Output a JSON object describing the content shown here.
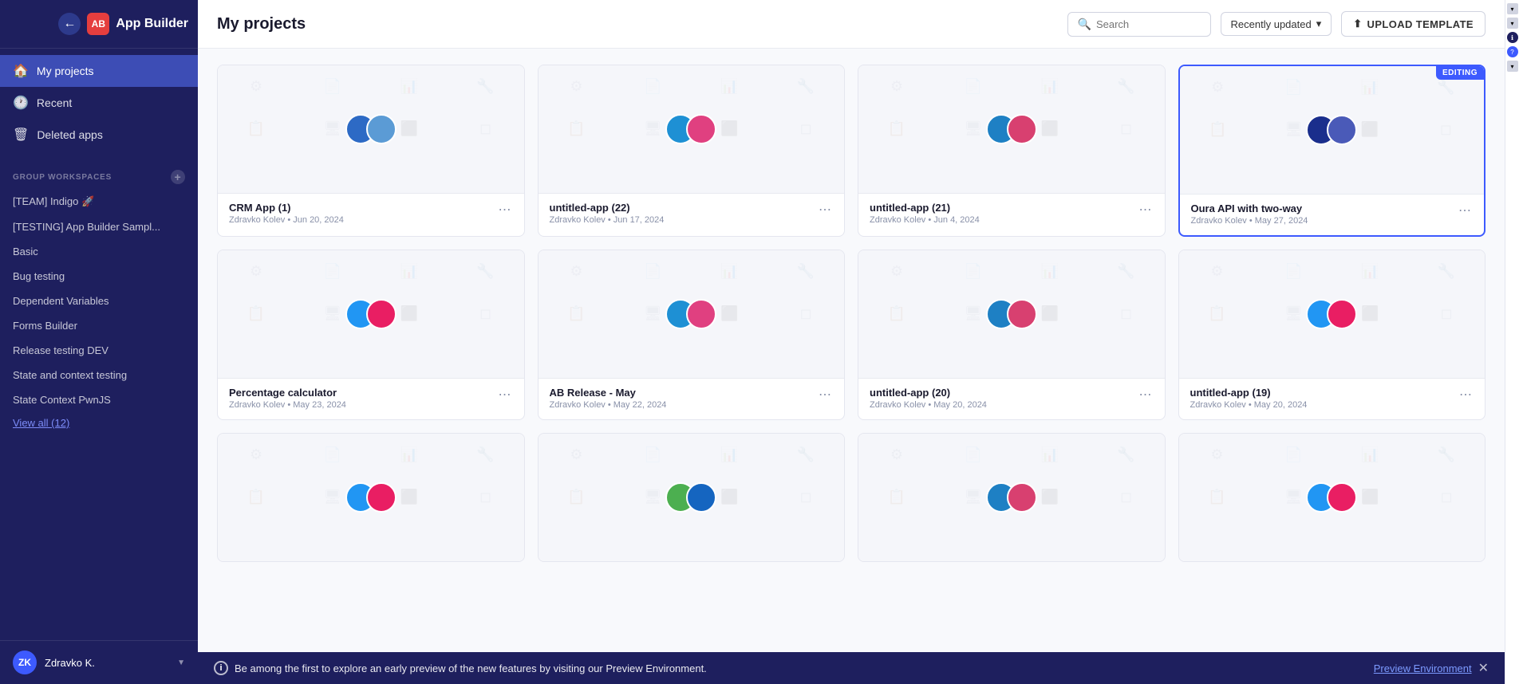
{
  "app": {
    "title": "App Builder",
    "logo_initials": "AB"
  },
  "sidebar": {
    "nav": [
      {
        "id": "my-projects",
        "label": "My projects",
        "icon": "🏠",
        "active": true
      },
      {
        "id": "recent",
        "label": "Recent",
        "icon": "🕐",
        "active": false
      },
      {
        "id": "deleted-apps",
        "label": "Deleted apps",
        "icon": "🗑",
        "active": false
      }
    ],
    "group_workspaces_label": "GROUP WORKSPACES",
    "workspaces": [
      {
        "id": "ws-team-indigo",
        "label": "[TEAM] Indigo 🚀"
      },
      {
        "id": "ws-testing-sample",
        "label": "[TESTING] App Builder Sampl..."
      },
      {
        "id": "ws-basic",
        "label": "Basic"
      },
      {
        "id": "ws-bug-testing",
        "label": "Bug testing"
      },
      {
        "id": "ws-dependent-vars",
        "label": "Dependent Variables"
      },
      {
        "id": "ws-forms-builder",
        "label": "Forms Builder"
      },
      {
        "id": "ws-release-testing",
        "label": "Release testing DEV"
      },
      {
        "id": "ws-state-context",
        "label": "State and context testing"
      },
      {
        "id": "ws-state-context-pwnjs",
        "label": "State Context PwnJS"
      }
    ],
    "view_all_label": "View all (12)",
    "user": {
      "initials": "ZK",
      "name": "Zdravko K."
    }
  },
  "header": {
    "title": "My projects",
    "search_placeholder": "Search",
    "sort_label": "Recently updated",
    "upload_label": "UPLOAD TEMPLATE"
  },
  "cards": [
    {
      "id": "crm-app",
      "title": "CRM App (1)",
      "name": "CRM App (1)",
      "author": "Zdravko Kolev",
      "date": "Jun 20, 2024",
      "editing": false,
      "color1": "#2d6ac5",
      "color2": "#5b9bd5"
    },
    {
      "id": "untitled-22",
      "title": "untitled-app (22)",
      "name": "untitled-app (22)",
      "author": "Zdravko Kolev",
      "date": "Jun 17, 2024",
      "editing": false,
      "color1": "#1e90d4",
      "color2": "#e04080"
    },
    {
      "id": "untitled-21",
      "title": "untitled-app (21)",
      "name": "untitled-app (21)",
      "author": "Zdravko Kolev",
      "date": "Jun 4, 2024",
      "editing": false,
      "color1": "#1e80c4",
      "color2": "#d84070"
    },
    {
      "id": "oura-api",
      "title": "Oura API with two-way",
      "name": "Oura API with two-way",
      "author": "Zdravko Kolev",
      "date": "May 27, 2024",
      "editing": true,
      "editing_badge": "EDITING",
      "color1": "#1a2e8c",
      "color2": "#4a5ab8"
    },
    {
      "id": "percentage-calc",
      "title": "Percentage calculator",
      "name": "Percentage calculator",
      "author": "Zdravko Kolev",
      "date": "May 23, 2024",
      "editing": false,
      "color1": "#2196f3",
      "color2": "#e91e63"
    },
    {
      "id": "ab-release",
      "title": "AB Release - May",
      "name": "AB Release - May",
      "author": "Zdravko Kolev",
      "date": "May 22, 2024",
      "editing": false,
      "color1": "#1e90d4",
      "color2": "#e04080"
    },
    {
      "id": "untitled-20",
      "title": "untitled-app (20)",
      "name": "untitled-app (20)",
      "author": "Zdravko Kolev",
      "date": "May 20, 2024",
      "editing": false,
      "color1": "#1e80c4",
      "color2": "#d84070"
    },
    {
      "id": "untitled-19",
      "title": "untitled-app (19)",
      "name": "untitled-app (19)",
      "author": "Zdravko Kolev",
      "date": "May 20, 2024",
      "editing": false,
      "color1": "#2196f3",
      "color2": "#e91e63"
    },
    {
      "id": "card-row3-1",
      "title": "",
      "name": "",
      "author": "",
      "date": "",
      "editing": false,
      "color1": "#2196f3",
      "color2": "#e91e63",
      "partial": true
    },
    {
      "id": "card-row3-2",
      "title": "",
      "name": "",
      "author": "",
      "date": "",
      "editing": false,
      "color1": "#4caf50",
      "color2": "#1565c0",
      "partial": true
    },
    {
      "id": "card-row3-3",
      "title": "",
      "name": "",
      "author": "",
      "date": "",
      "editing": false,
      "color1": "#1e80c4",
      "color2": "#d84070",
      "partial": true
    },
    {
      "id": "card-row3-4",
      "title": "",
      "name": "",
      "author": "",
      "date": "",
      "editing": false,
      "color1": "#2196f3",
      "color2": "#e91e63",
      "partial": true
    }
  ],
  "banner": {
    "text": "Be among the first to explore an early preview of the new features by visiting our Preview Environment.",
    "link_text": "Preview Environment",
    "link_url": "#"
  },
  "right_aside": {
    "buttons": [
      "▾",
      "▾",
      "ℹ",
      "?",
      "▾"
    ]
  }
}
